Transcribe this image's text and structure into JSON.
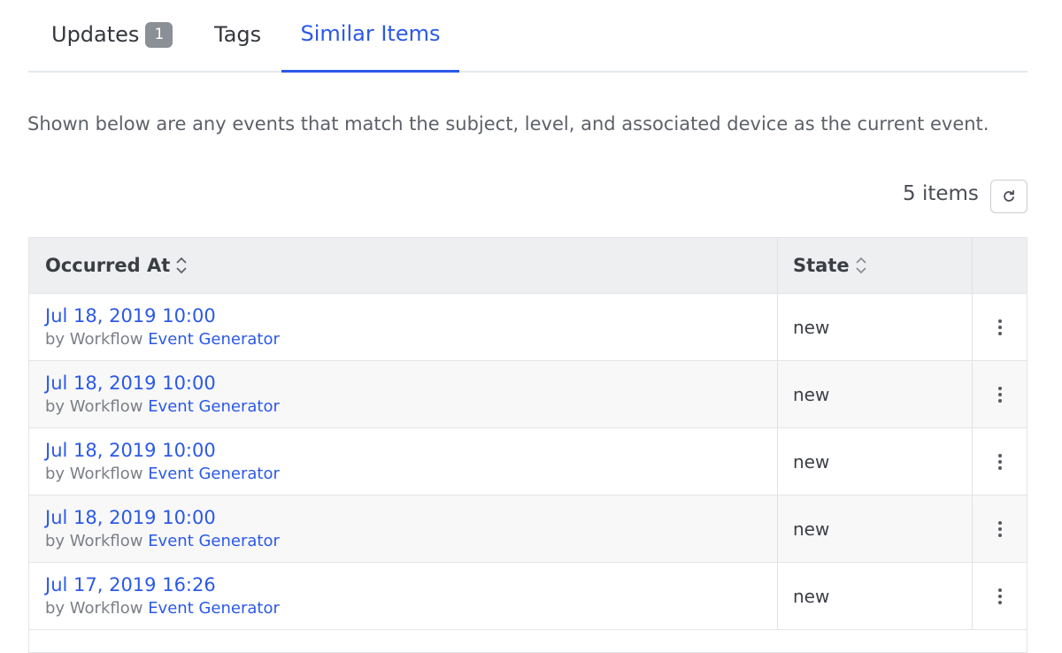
{
  "tabs": {
    "updates": "Updates",
    "updates_badge": "1",
    "tags": "Tags",
    "similar": "Similar Items"
  },
  "description": "Shown below are any events that match the subject, level, and associated device as the current event.",
  "count_text": "5 items",
  "icons": {
    "refresh": "refresh-icon",
    "sort": "sort-icon",
    "kebab": "kebab-menu-icon"
  },
  "colors": {
    "accent": "#2b59e8",
    "header_bg": "#eeeff1"
  },
  "table": {
    "headers": {
      "occurred": "Occurred At",
      "state": "State"
    },
    "rows": [
      {
        "date": "Jul 18, 2019 10:00",
        "by_prefix": "by Workflow",
        "by_link": "Event Generator",
        "state": "new"
      },
      {
        "date": "Jul 18, 2019 10:00",
        "by_prefix": "by Workflow",
        "by_link": "Event Generator",
        "state": "new"
      },
      {
        "date": "Jul 18, 2019 10:00",
        "by_prefix": "by Workflow",
        "by_link": "Event Generator",
        "state": "new"
      },
      {
        "date": "Jul 18, 2019 10:00",
        "by_prefix": "by Workflow",
        "by_link": "Event Generator",
        "state": "new"
      },
      {
        "date": "Jul 17, 2019 16:26",
        "by_prefix": "by Workflow",
        "by_link": "Event Generator",
        "state": "new"
      }
    ]
  }
}
